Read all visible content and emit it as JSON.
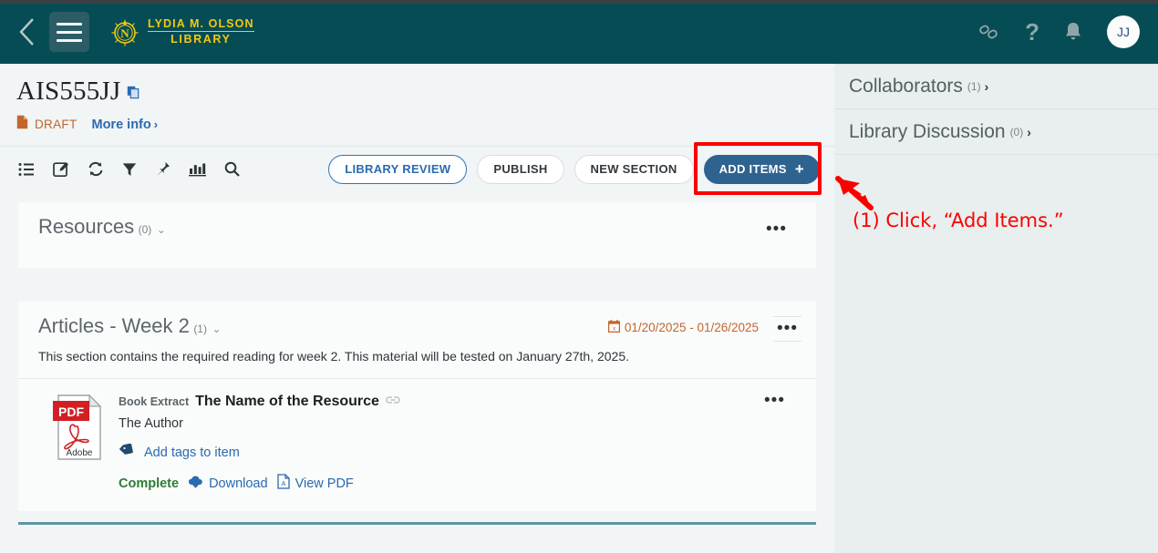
{
  "header": {
    "back_icon": "chevron-left-icon",
    "menu_icon": "hamburger-menu-icon",
    "brand_line1": "LYDIA M. OLSON",
    "brand_line2": "LIBRARY",
    "link_icon": "chain-link-icon",
    "help_icon": "question-mark-icon",
    "help_label": "?",
    "bell_icon": "bell-icon",
    "avatar_initials": "JJ",
    "bg_color": "#064c55",
    "brand_color": "#f3c911"
  },
  "page": {
    "title": "AIS555JJ",
    "copy_icon": "copy-pages-icon",
    "status_icon": "document-icon",
    "status_label": "DRAFT",
    "status_color": "#c2662c",
    "more_info_label": "More info",
    "more_info_chevron": "›"
  },
  "toolbar": {
    "icons": [
      {
        "name": "list-view-icon"
      },
      {
        "name": "edit-icon"
      },
      {
        "name": "refresh-icon"
      },
      {
        "name": "filter-icon"
      },
      {
        "name": "pin-icon"
      },
      {
        "name": "analytics-icon"
      },
      {
        "name": "search-icon"
      }
    ],
    "library_review_label": "LIBRARY REVIEW",
    "publish_label": "PUBLISH",
    "new_section_label": "NEW SECTION",
    "add_items_label": "ADD ITEMS",
    "add_items_plus": "+",
    "primary_color": "#2e638f"
  },
  "resources_section": {
    "title": "Resources",
    "count": "(0)",
    "chevron": "⌄",
    "menu_dots": "•••"
  },
  "articles_section": {
    "title": "Articles - Week 2",
    "count": "(1)",
    "chevron": "⌄",
    "calendar_icon": "calendar-icon",
    "date_range": "01/20/2025 - 01/26/2025",
    "menu_dots": "•••",
    "description": "This section contains the required reading for week 2. This material will be tested on January 27th, 2025.",
    "item": {
      "file_icon": "pdf-file-icon",
      "file_icon_label": "PDF",
      "file_icon_brand": "Adobe",
      "kind": "Book Extract",
      "title": "The Name of the Resource",
      "title_link_icon": "link-icon",
      "author": "The Author",
      "tag_icon": "tag-icon",
      "tag_label": "Add tags to item",
      "status_label": "Complete",
      "status_color": "#2e7d32",
      "download_icon": "cloud-download-icon",
      "download_label": "Download",
      "view_pdf_icon": "pdf-document-icon",
      "view_pdf_label": "View PDF",
      "menu_dots": "•••"
    }
  },
  "sidebar": {
    "items": [
      {
        "label": "Collaborators",
        "count": "(1)",
        "chevron": "›"
      },
      {
        "label": "Library Discussion",
        "count": "(0)",
        "chevron": "›"
      }
    ]
  },
  "annotation": {
    "text": "(1) Click, “Add Items.”",
    "color": "#fb0000",
    "arrow_icon": "red-arrow-icon",
    "highlight_icon": "red-highlight-box"
  }
}
